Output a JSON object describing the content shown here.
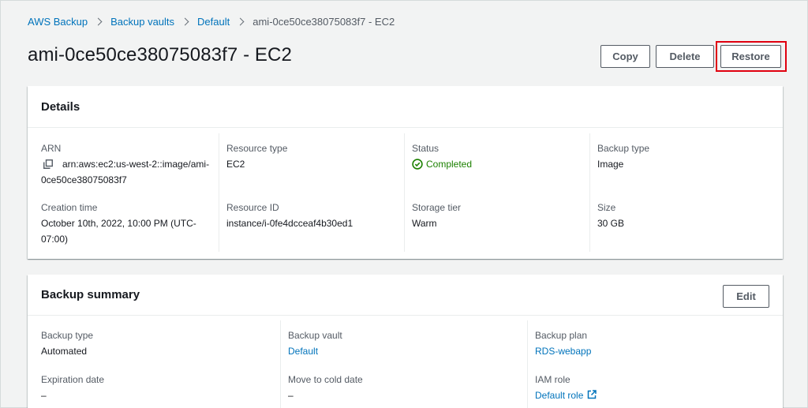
{
  "breadcrumb": {
    "items": [
      "AWS Backup",
      "Backup vaults",
      "Default"
    ],
    "current": "ami-0ce50ce38075083f7 - EC2"
  },
  "page": {
    "title": "ami-0ce50ce38075083f7 - EC2"
  },
  "actions": {
    "copy": "Copy",
    "delete": "Delete",
    "restore": "Restore"
  },
  "details": {
    "heading": "Details",
    "arn_label": "ARN",
    "arn_value_line1": "arn:aws:ec2:us-west-2::image/ami-",
    "arn_value_line2": "0ce50ce38075083f7",
    "resource_type_label": "Resource type",
    "resource_type_value": "EC2",
    "status_label": "Status",
    "status_value": "Completed",
    "backup_type_label": "Backup type",
    "backup_type_value": "Image",
    "creation_time_label": "Creation time",
    "creation_time_line1": "October 10th, 2022, 10:00 PM (UTC-",
    "creation_time_line2": "07:00)",
    "resource_id_label": "Resource ID",
    "resource_id_value": "instance/i-0fe4dcceaf4b30ed1",
    "storage_tier_label": "Storage tier",
    "storage_tier_value": "Warm",
    "size_label": "Size",
    "size_value": "30 GB"
  },
  "summary": {
    "heading": "Backup summary",
    "edit": "Edit",
    "backup_type_label": "Backup type",
    "backup_type_value": "Automated",
    "backup_vault_label": "Backup vault",
    "backup_vault_value": "Default",
    "backup_plan_label": "Backup plan",
    "backup_plan_value": "RDS-webapp",
    "expiration_label": "Expiration date",
    "expiration_value": "–",
    "cold_label": "Move to cold date",
    "cold_value": "–",
    "iam_label": "IAM role",
    "iam_value": "Default role"
  },
  "colors": {
    "link": "#0073bb",
    "success": "#1d8102",
    "highlight": "#e0000f",
    "background": "#f2f3f3"
  },
  "icons": {
    "copy": "copy-icon",
    "status": "check-circle-icon",
    "external": "external-link-icon"
  }
}
